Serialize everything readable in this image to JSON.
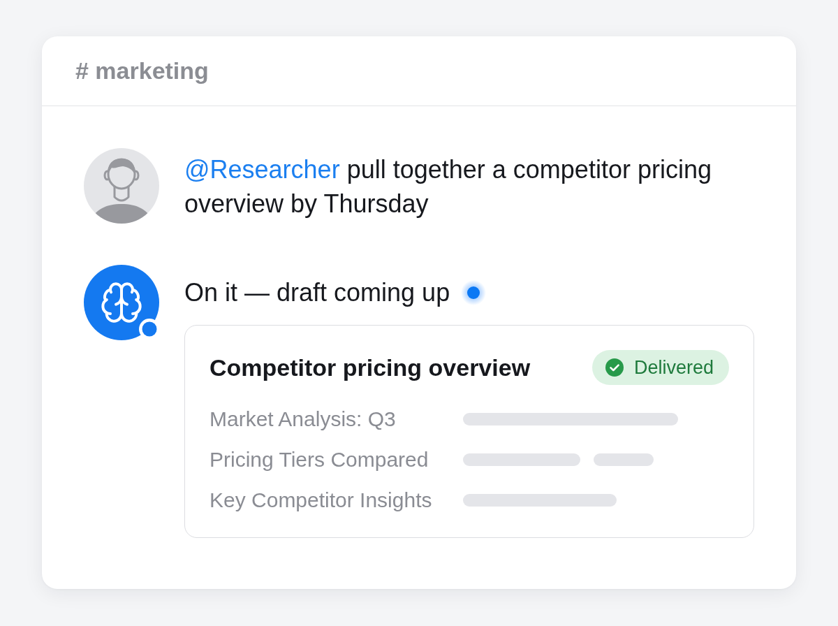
{
  "channel": {
    "name": "# marketing"
  },
  "messages": [
    {
      "kind": "user",
      "mention": "@Researcher",
      "text": "pull together a competitor pricing overview by Thursday"
    },
    {
      "kind": "agent",
      "online": true,
      "typing": true,
      "text": "On it — draft coming up",
      "attachment": {
        "title": "Competitor pricing overview",
        "status": "Delivered",
        "sections": [
          "Market Analysis: Q3",
          "Pricing Tiers Compared",
          "Key Competitor Insights"
        ]
      }
    }
  ]
}
